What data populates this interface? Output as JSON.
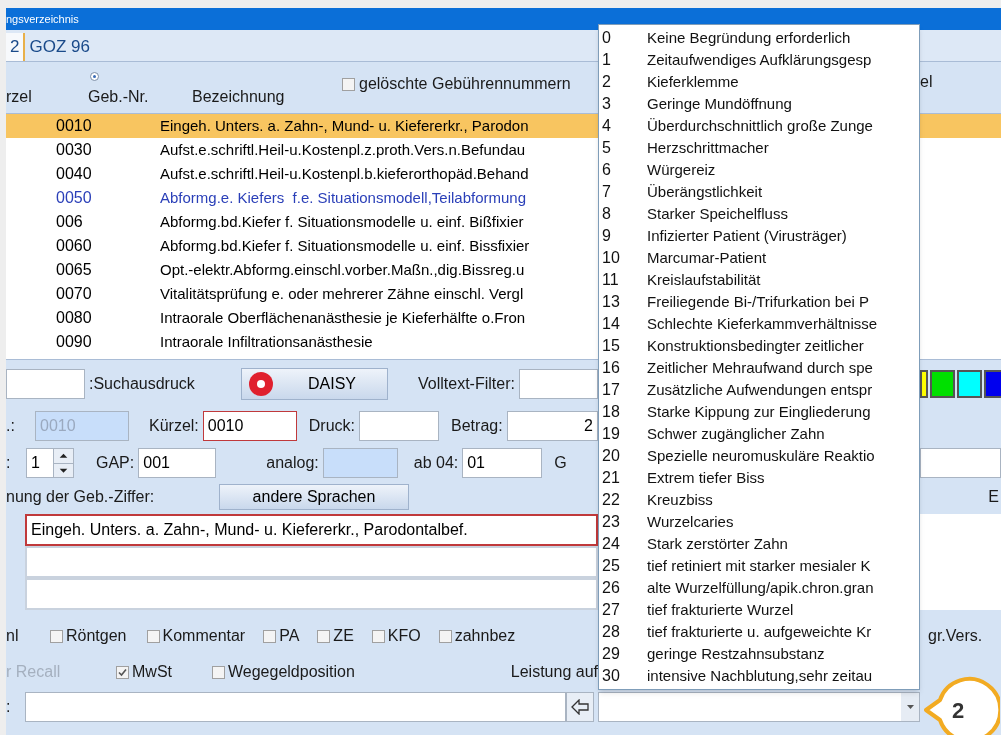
{
  "window": {
    "title": "ngsverzeichnis"
  },
  "tabs": [
    {
      "label": "2",
      "selected": true
    },
    {
      "label": "GOZ 96",
      "selected": false
    }
  ],
  "list_header": {
    "radio": {
      "selected": true
    },
    "columns": [
      "rzel",
      "Geb.-Nr.",
      "Bezeichnung"
    ],
    "deleted_checkbox": {
      "label": "gelöschte Gebührennummern",
      "checked": false
    },
    "right_label": "el"
  },
  "rows": [
    {
      "code": "0010",
      "text": "Eingeh. Unters. a. Zahn-, Mund- u. Kiefererkr., Parodon",
      "selected": true,
      "marked": false
    },
    {
      "code": "0030",
      "text": "Aufst.e.schriftl.Heil-u.Kostenpl.z.proth.Vers.n.Befundau",
      "selected": false,
      "marked": false
    },
    {
      "code": "0040",
      "text": "Aufst.e.schriftl.Heil-u.Kostenpl.b.kieferorthopäd.Behand",
      "selected": false,
      "marked": false
    },
    {
      "code": "0050",
      "text": "Abformg.e. Kiefers  f.e. Situationsmodell,Teilabformung",
      "selected": false,
      "marked": true
    },
    {
      "code": "006",
      "text": "Abformg.bd.Kiefer f. Situationsmodelle u. einf. Bißfixier",
      "selected": false,
      "marked": false
    },
    {
      "code": "0060",
      "text": "Abformg.bd.Kiefer f. Situationsmodelle u. einf. Bissfixier",
      "selected": false,
      "marked": false
    },
    {
      "code": "0065",
      "text": "Opt.-elektr.Abformg.einschl.vorber.Maßn.,dig.Bissreg.u",
      "selected": false,
      "marked": false
    },
    {
      "code": "0070",
      "text": "Vitalitätsprüfung e. oder mehrerer Zähne einschl. Vergl",
      "selected": false,
      "marked": false
    },
    {
      "code": "0080",
      "text": "Intraorale Oberflächenanästhesie je Kieferhälfte o.Fron",
      "selected": false,
      "marked": false
    },
    {
      "code": "0090",
      "text": "Intraorale Infiltrationsanästhesie",
      "selected": false,
      "marked": false
    }
  ],
  "form": {
    "search_label": ":Suchausdruck",
    "daisy_button": "DAISY",
    "fulltext_label": "Volltext-Filter:",
    "number_label": ".:",
    "number_field": {
      "value": "0010",
      "disabled": true
    },
    "short_label": "Kürzel:",
    "short_field": {
      "value": "0010",
      "focused": true
    },
    "print_label": "Druck:",
    "amount_label": "Betrag:",
    "amount_field": {
      "value": "2"
    },
    "count_label": ":",
    "count_spinner": {
      "value": "1"
    },
    "gap_label": "GAP:",
    "gap_field": {
      "value": "001"
    },
    "analog_label": "analog:",
    "analog_field": {
      "disabled": true
    },
    "ab04_label": "ab 04:",
    "ab04_field": {
      "value": "01"
    },
    "g_label": "G",
    "description_label": "nung der Geb.-Ziffer:",
    "languages_button": "andere Sprachen",
    "right_label": "E",
    "description_fields": [
      {
        "value": "Eingeh. Unters. a. Zahn-, Mund- u. Kiefererkr., Parodontalbef.",
        "focused": true
      },
      {
        "focused": false
      },
      {
        "focused": false
      }
    ],
    "flags_label": "nl",
    "flags": [
      {
        "label": "Röntgen",
        "checked": false
      },
      {
        "label": "Kommentar",
        "checked": false
      },
      {
        "label": "PA",
        "checked": false
      },
      {
        "label": "ZE",
        "checked": false
      },
      {
        "label": "KFO",
        "checked": false
      },
      {
        "label": "zahnbez",
        "checked": false
      }
    ],
    "flags_right_label": "gr.Vers.",
    "recall_label": {
      "label": "r Recall",
      "disabled": true
    },
    "options": [
      {
        "label": "MwSt",
        "checked": true
      },
      {
        "label": "Wegegeldposition",
        "checked": false
      }
    ],
    "service_label": "Leistung auf",
    "note_label": ":"
  },
  "swatches": [
    {
      "color": "#ffff00"
    },
    {
      "color": "#00e000"
    },
    {
      "color": "#00ffff"
    },
    {
      "color": "#0000ee"
    }
  ],
  "dropdown": {
    "items": [
      {
        "number": "0",
        "text": "Keine Begründung erforderlich"
      },
      {
        "number": "1",
        "text": "Zeitaufwendiges Aufklärungsgesp"
      },
      {
        "number": "2",
        "text": "Kieferklemme"
      },
      {
        "number": "3",
        "text": "Geringe Mundöffnung"
      },
      {
        "number": "4",
        "text": "Überdurchschnittlich große Zunge"
      },
      {
        "number": "5",
        "text": "Herzschrittmacher"
      },
      {
        "number": "6",
        "text": "Würgereiz"
      },
      {
        "number": "7",
        "text": "Überängstlichkeit"
      },
      {
        "number": "8",
        "text": "Starker Speichelfluss"
      },
      {
        "number": "9",
        "text": "Infizierter Patient (Virusträger)"
      },
      {
        "number": "10",
        "text": "Marcumar-Patient"
      },
      {
        "number": "11",
        "text": "Kreislaufstabilität"
      },
      {
        "number": "13",
        "text": "Freiliegende Bi-/Trifurkation bei P"
      },
      {
        "number": "14",
        "text": "Schlechte Kieferkammverhältnisse"
      },
      {
        "number": "15",
        "text": "Konstruktionsbedingter zeitlicher"
      },
      {
        "number": "16",
        "text": "Zeitlicher Mehraufwand durch spe"
      },
      {
        "number": "17",
        "text": "Zusätzliche Aufwendungen entspr"
      },
      {
        "number": "18",
        "text": "Starke Kippung zur Eingliederung"
      },
      {
        "number": "19",
        "text": "Schwer zugänglicher Zahn"
      },
      {
        "number": "20",
        "text": "Spezielle neuromuskuläre Reaktio"
      },
      {
        "number": "21",
        "text": "Extrem tiefer Biss"
      },
      {
        "number": "22",
        "text": "Kreuzbiss"
      },
      {
        "number": "23",
        "text": "Wurzelcaries"
      },
      {
        "number": "24",
        "text": "Stark zerstörter Zahn"
      },
      {
        "number": "25",
        "text": "tief retiniert mit starker mesialer K"
      },
      {
        "number": "26",
        "text": "alte Wurzelfüllung/apik.chron.gran"
      },
      {
        "number": "27",
        "text": "tief frakturierte Wurzel"
      },
      {
        "number": "28",
        "text": "tief frakturierte u. aufgeweichte Kr"
      },
      {
        "number": "29",
        "text": "geringe Restzahnsubstanz"
      },
      {
        "number": "30",
        "text": "intensive Nachblutung,sehr zeitau"
      }
    ]
  },
  "callout": {
    "label": "2"
  }
}
